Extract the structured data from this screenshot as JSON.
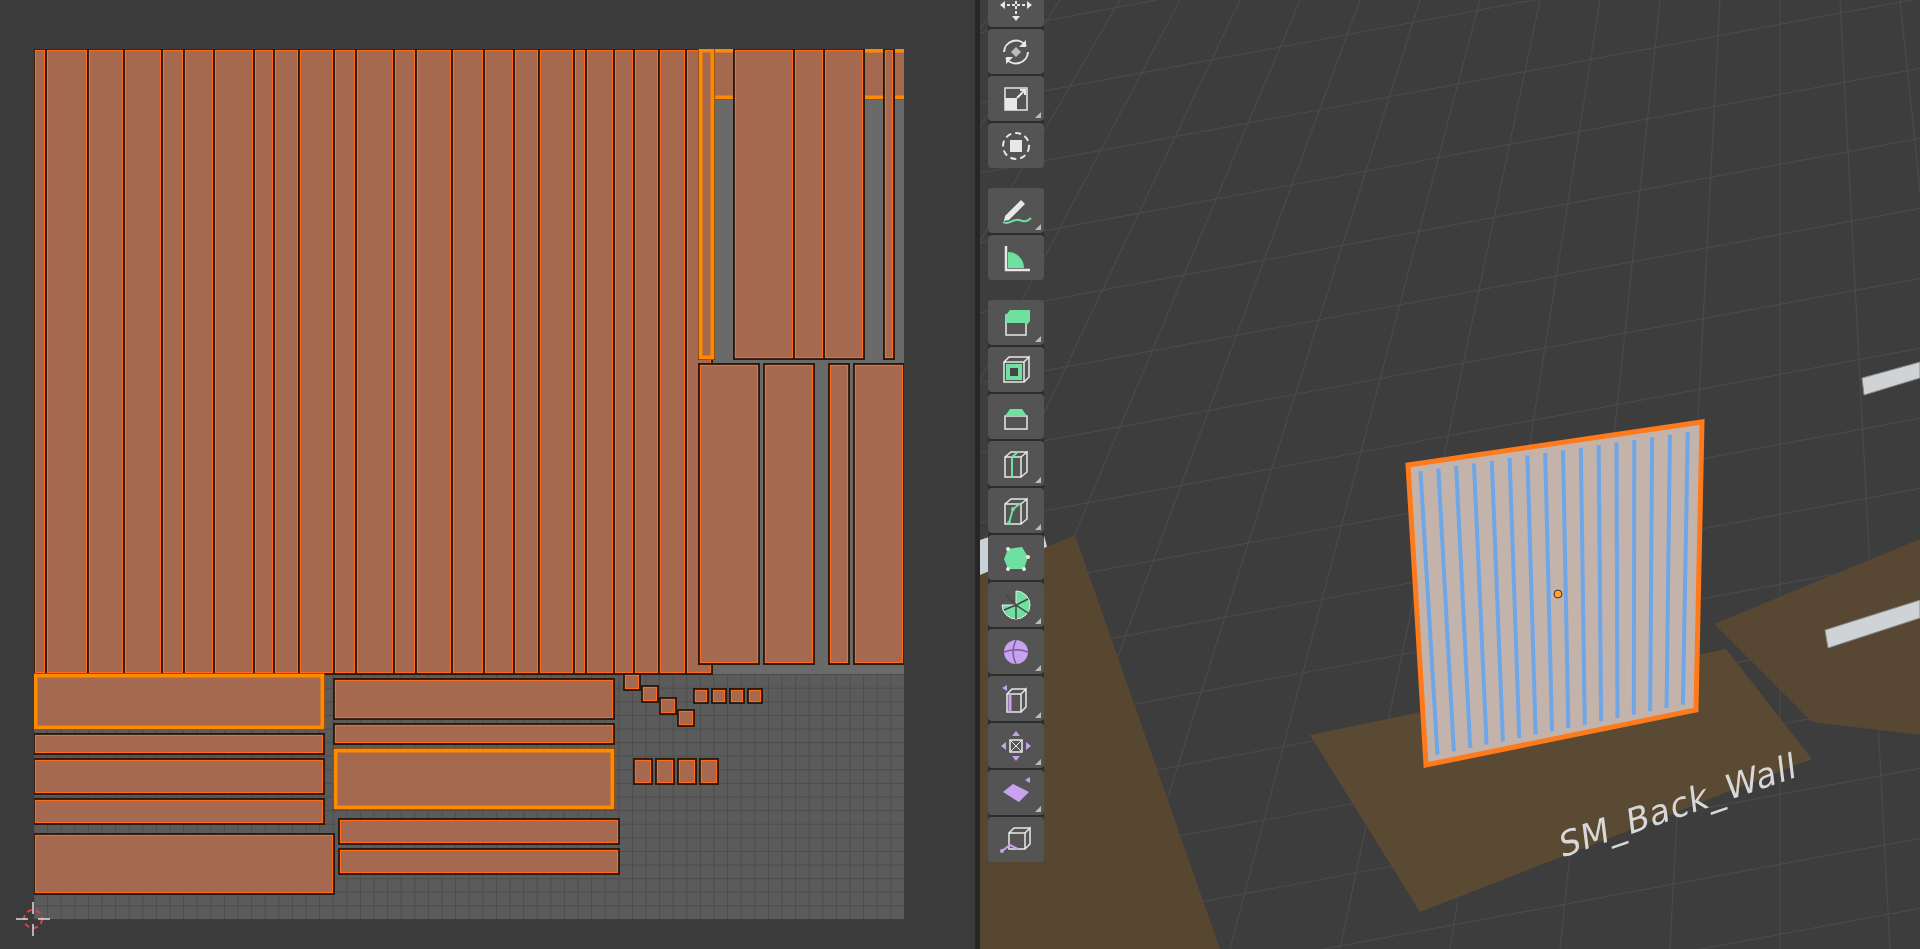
{
  "toolbar": {
    "groups": [
      {
        "tools": [
          {
            "kind": "move",
            "submenu": false
          },
          {
            "kind": "rotate",
            "submenu": false
          },
          {
            "kind": "scale",
            "submenu": true
          },
          {
            "kind": "transform",
            "submenu": false
          }
        ]
      },
      {
        "tools": [
          {
            "kind": "annotate",
            "submenu": true
          },
          {
            "kind": "measure",
            "submenu": false
          }
        ]
      },
      {
        "tools": [
          {
            "kind": "extrude",
            "submenu": true
          },
          {
            "kind": "inset",
            "submenu": false
          },
          {
            "kind": "bevel",
            "submenu": false
          },
          {
            "kind": "loopcut",
            "submenu": true
          },
          {
            "kind": "knife",
            "submenu": true
          },
          {
            "kind": "polybuild",
            "submenu": false
          },
          {
            "kind": "spin",
            "submenu": true
          },
          {
            "kind": "smooth",
            "submenu": true
          },
          {
            "kind": "edgeslide",
            "submenu": true
          },
          {
            "kind": "shrink",
            "submenu": true
          },
          {
            "kind": "shear",
            "submenu": true
          },
          {
            "kind": "rip",
            "submenu": false
          }
        ]
      }
    ]
  },
  "viewport": {
    "object": {
      "label": "SM_Back_Wall",
      "selected": true
    }
  }
}
